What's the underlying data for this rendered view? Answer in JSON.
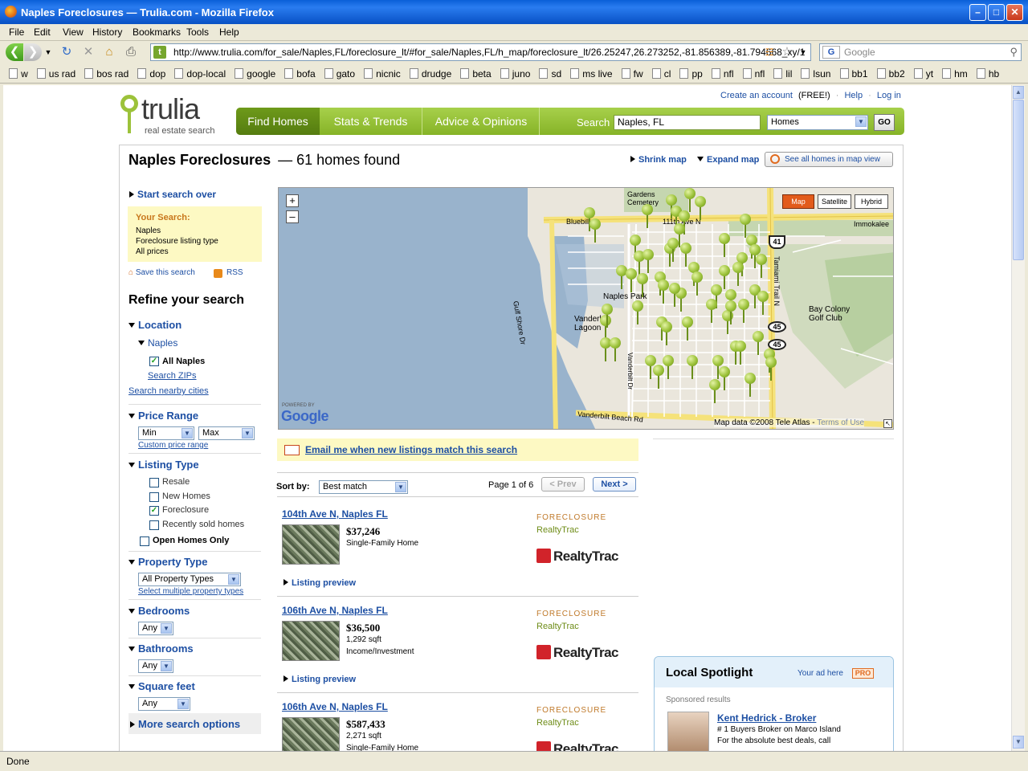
{
  "window": {
    "title": "Naples Foreclosures — Trulia.com - Mozilla Firefox"
  },
  "menu": [
    "File",
    "Edit",
    "View",
    "History",
    "Bookmarks",
    "Tools",
    "Help"
  ],
  "navbar": {
    "url": "http://www.trulia.com/for_sale/Naples,FL/foreclosure_lt/#for_sale/Naples,FL/h_map/foreclosure_lt/26.25247,26.273252,-81.856389,-81.794668_xy/1",
    "search_placeholder": "Google"
  },
  "bookmarks": [
    "w",
    "us rad",
    "bos rad",
    "dop",
    "dop-local",
    "google",
    "bofa",
    "gato",
    "nicnic",
    "drudge",
    "beta",
    "juno",
    "sd",
    "ms live",
    "fw",
    "cl",
    "pp",
    "nfl",
    "nfl",
    "lil",
    "lsun",
    "bb1",
    "bb2",
    "yt",
    "hm",
    "hb"
  ],
  "status": "Done",
  "header": {
    "logo": "trulia",
    "tagline": "real estate search",
    "top_links": [
      "Create an account",
      "(FREE!)",
      "Help",
      "Log in"
    ],
    "tabs": [
      "Find Homes",
      "Stats & Trends",
      "Advice & Opinions"
    ],
    "search_label": "Search",
    "search_value": "Naples, FL",
    "search_type": "Homes",
    "go": "GO"
  },
  "page": {
    "heading": "Naples Foreclosures",
    "count": "— 61 homes found",
    "shrink": "Shrink map",
    "expand": "Expand map",
    "see_all": "See all homes in map view"
  },
  "sidebar": {
    "start_over": "Start search over",
    "your_search_label": "Your Search:",
    "your_search": [
      "Naples",
      "Foreclosure listing type",
      "All prices"
    ],
    "save": "Save this search",
    "rss": "RSS",
    "refine": "Refine your search",
    "location": "Location",
    "city": "Naples",
    "all_city": "All Naples",
    "search_zips": "Search ZIPs",
    "nearby": "Search nearby cities",
    "price_range": "Price Range",
    "min": "Min",
    "max": "Max",
    "custom_price": "Custom price range",
    "listing_type": "Listing Type",
    "types": [
      {
        "label": "Resale",
        "checked": false
      },
      {
        "label": "New Homes",
        "checked": false
      },
      {
        "label": "Foreclosure",
        "checked": true
      },
      {
        "label": "Recently sold homes",
        "checked": false
      }
    ],
    "open_homes": "Open Homes Only",
    "property_type": "Property Type",
    "property_value": "All Property Types",
    "multiple": "Select multiple property types",
    "bedrooms": "Bedrooms",
    "bed_value": "Any",
    "bathrooms": "Bathrooms",
    "bath_value": "Any",
    "sqft": "Square feet",
    "sqft_value": "Any",
    "more": "More search options"
  },
  "map": {
    "buttons": [
      "Map",
      "Satellite",
      "Hybrid"
    ],
    "labels": [
      "Gardens Cemetery",
      "Bluebill",
      "111th Ave N",
      "Immokalee",
      "Gulf Shore Dr",
      "Naples Park",
      "Vanderbilt Lagoon",
      "Vanderbilt Dr",
      "Tamiami Trail N",
      "Bay Colony Golf Club",
      "Vanderbilt Beach Rd",
      "41",
      "45",
      "45"
    ],
    "powered": "POWERED BY",
    "google": "Google",
    "credit": "Map data ©2008 Tele Atlas -",
    "terms": "Terms of Use"
  },
  "email_alert": "Email me when new listings match this search",
  "sort": {
    "label": "Sort by:",
    "value": "Best match",
    "page": "Page 1 of 6",
    "prev": "< Prev",
    "next": "Next >"
  },
  "listings": [
    {
      "address": "104th Ave N, Naples FL",
      "price": "$37,246",
      "line1": "Single-Family Home",
      "line2": "",
      "tag": "FORECLOSURE",
      "source": "RealtyTrac",
      "logo": "RealtyTrac",
      "preview": "Listing preview"
    },
    {
      "address": "106th Ave N, Naples FL",
      "price": "$36,500",
      "line1": "1,292 sqft",
      "line2": "Income/Investment",
      "tag": "FORECLOSURE",
      "source": "RealtyTrac",
      "logo": "RealtyTrac",
      "preview": "Listing preview"
    },
    {
      "address": "106th Ave N, Naples FL",
      "price": "$587,433",
      "line1": "2,271 sqft",
      "line2": "Single-Family Home",
      "tag": "FORECLOSURE",
      "source": "RealtyTrac",
      "logo": "RealtyTrac",
      "preview": ""
    }
  ],
  "spotlight": {
    "title": "Local Spotlight",
    "ad": "Your ad here",
    "pro": "PRO",
    "sponsored": "Sponsored results",
    "name": "Kent Hedrick - Broker",
    "line1": "# 1 Buyers Broker on Marco Island",
    "line2": "For the absolute best deals, call"
  }
}
